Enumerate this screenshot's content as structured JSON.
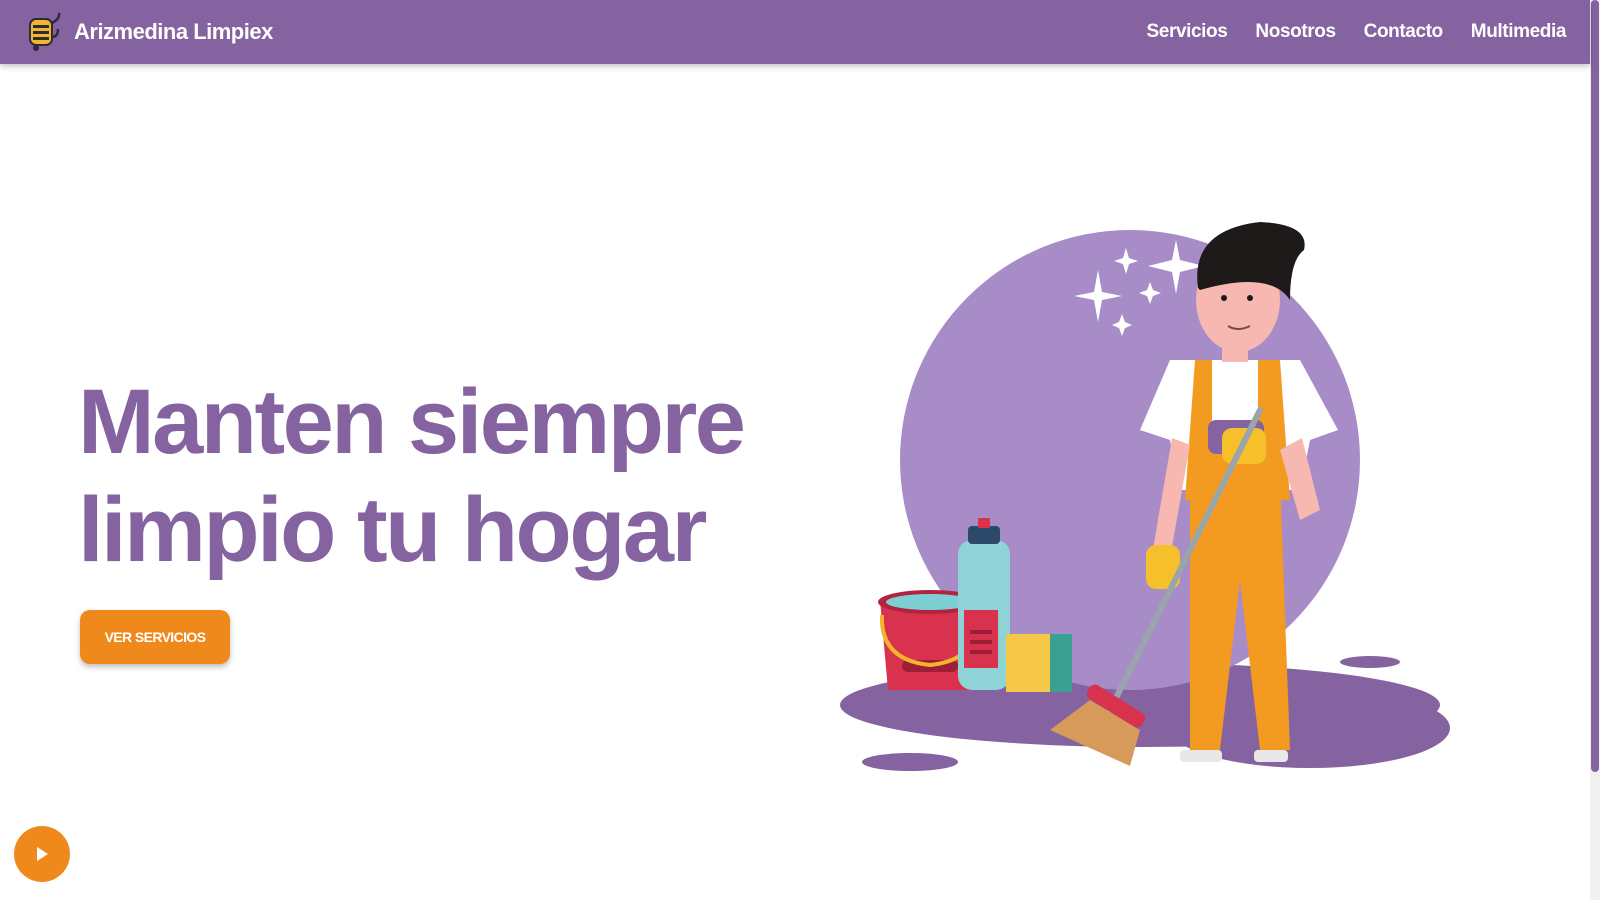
{
  "brand": {
    "name": "Arizmedina Limpiex",
    "logo_icon": "vacuum-cleaner-icon"
  },
  "nav": {
    "items": [
      {
        "label": "Servicios"
      },
      {
        "label": "Nosotros"
      },
      {
        "label": "Contacto"
      },
      {
        "label": "Multimedia"
      }
    ]
  },
  "hero": {
    "title_line1": "Manten siempre",
    "title_line2": "limpio tu hogar",
    "cta_label": "VER SERVICIOS",
    "illustration": "cleaner-with-broom-illustration"
  },
  "media": {
    "play_icon": "play-icon"
  },
  "colors": {
    "primary": "#8562a0",
    "accent": "#f0891c",
    "background": "#ffffff"
  }
}
